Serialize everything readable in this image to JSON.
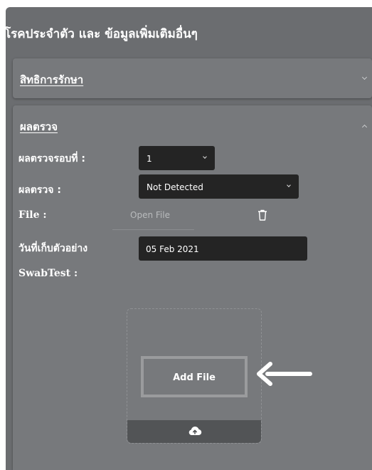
{
  "section_title": "โรคประจำตัว และ ข้อมูลเพิ่มเติมอื่นๆ",
  "accordion_rights": {
    "title": "สิทธิการรักษา",
    "expanded": false
  },
  "accordion_results": {
    "title": "ผลตรวจ",
    "expanded": true,
    "fields": {
      "round_label": "ผลตรวจรอบที่ :",
      "round_value": "1",
      "result_label": "ผลตรวจ :",
      "result_value": "Not Detected",
      "file_label": "File :",
      "open_file": "Open File",
      "sample_date_label": "วันที่เก็บตัวอย่าง",
      "sample_date_value": "05 Feb 2021",
      "swab_label": "SwabTest :"
    },
    "upload": {
      "add_file_label": "Add File"
    }
  },
  "colors": {
    "panel": "#6b6d70",
    "card": "#77797c",
    "input": "#242424",
    "text": "#ffffff"
  },
  "icons": [
    "chevron-down-icon",
    "chevron-up-icon",
    "trash-icon",
    "upload-cloud-icon",
    "arrow-left-icon"
  ]
}
